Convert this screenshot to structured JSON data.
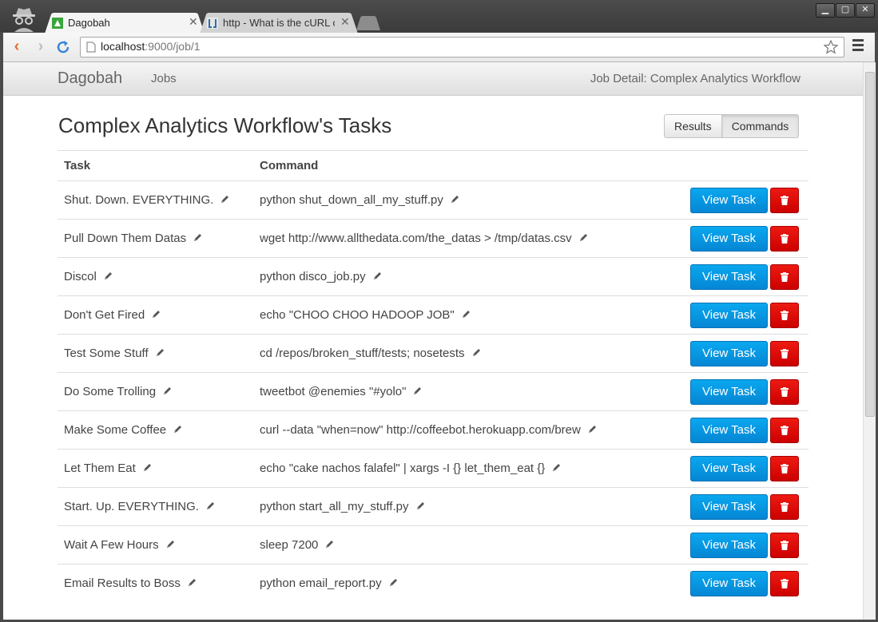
{
  "browser": {
    "tabs": [
      {
        "title": "Dagobah"
      },
      {
        "title": "http - What is the cURL c"
      }
    ],
    "url_host": "localhost",
    "url_path": ":9000/job/1"
  },
  "navbar": {
    "brand": "Dagobah",
    "jobs_link": "Jobs",
    "breadcrumb": "Job Detail: Complex Analytics Workflow"
  },
  "main": {
    "title": "Complex Analytics Workflow's Tasks",
    "toggle": {
      "results": "Results",
      "commands": "Commands"
    },
    "columns": {
      "task": "Task",
      "command": "Command"
    },
    "view_label": "View Task",
    "tasks": [
      {
        "name": "Shut. Down. EVERYTHING.",
        "command": "python shut_down_all_my_stuff.py"
      },
      {
        "name": "Pull Down Them Datas",
        "command": "wget http://www.allthedata.com/the_datas > /tmp/datas.csv"
      },
      {
        "name": "Discol",
        "command": "python disco_job.py"
      },
      {
        "name": "Don't Get Fired",
        "command": "echo \"CHOO CHOO HADOOP JOB\""
      },
      {
        "name": "Test Some Stuff",
        "command": "cd /repos/broken_stuff/tests; nosetests"
      },
      {
        "name": "Do Some Trolling",
        "command": "tweetbot @enemies \"#yolo\""
      },
      {
        "name": "Make Some Coffee",
        "command": "curl --data \"when=now\" http://coffeebot.herokuapp.com/brew"
      },
      {
        "name": "Let Them Eat",
        "command": "echo \"cake nachos falafel\" | xargs -I {} let_them_eat {}"
      },
      {
        "name": "Start. Up. EVERYTHING.",
        "command": "python start_all_my_stuff.py"
      },
      {
        "name": "Wait A Few Hours",
        "command": "sleep 7200"
      },
      {
        "name": "Email Results to Boss",
        "command": "python email_report.py"
      }
    ]
  },
  "colors": {
    "view_button": "#0b97e0",
    "delete_button": "#dd0000"
  }
}
